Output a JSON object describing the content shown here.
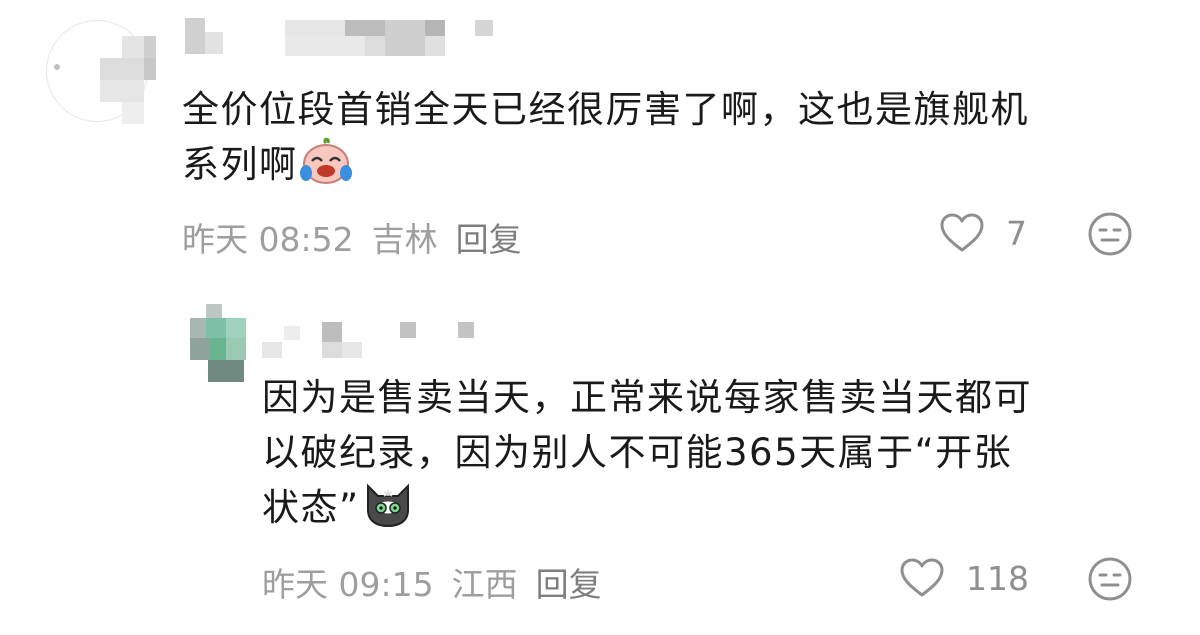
{
  "comments": [
    {
      "text_line1": "全价位段首销全天已经很厉害了啊，这也是旗舰机",
      "text_line2": "系列啊",
      "emoji": "crying-laughing-face-emoji",
      "time": "昨天 08:52",
      "location": "吉林",
      "reply_label": "回复",
      "likes": "7",
      "like_icon": "heart-outline-icon",
      "dislike_icon": "meh-face-icon"
    },
    {
      "text_line1": "因为是售卖当天，正常来说每家售卖当天都可",
      "text_line2": "以破纪录，因为别人不可能365天属于“开张",
      "text_line3": "状态”",
      "emoji": "gray-cat-emoji",
      "time": "昨天 09:15",
      "location": "江西",
      "reply_label": "回复",
      "likes": "118",
      "like_icon": "heart-outline-icon",
      "dislike_icon": "meh-face-icon"
    }
  ],
  "colors": {
    "text": "#1a1a1a",
    "meta": "#9e9e9e",
    "icon": "#8f8f8f"
  }
}
